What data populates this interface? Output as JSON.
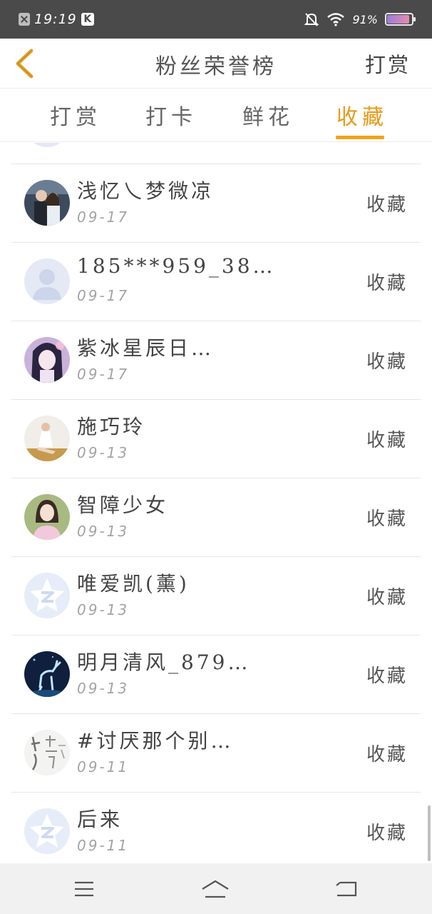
{
  "status_bar": {
    "time": "19:19",
    "battery_pct": "91%"
  },
  "header": {
    "title": "粉丝荣誉榜",
    "action": "打赏"
  },
  "tabs": [
    {
      "label": "打赏",
      "active": false
    },
    {
      "label": "打卡",
      "active": false
    },
    {
      "label": "鲜花",
      "active": false
    },
    {
      "label": "收藏",
      "active": true
    }
  ],
  "colors": {
    "accent": "#f0a21c",
    "status_bar": "#4a4a4a",
    "nav_bar": "#f1f1f1"
  },
  "list": [
    {
      "name": "浅忆乀梦微凉",
      "date": "09-17",
      "action": "收藏",
      "avatar": "photo-couple"
    },
    {
      "name": "185***959_38…",
      "date": "09-17",
      "action": "收藏",
      "avatar": "default-user"
    },
    {
      "name": "紫冰星辰日…",
      "date": "09-17",
      "action": "收藏",
      "avatar": "anime-girl"
    },
    {
      "name": "施巧玲",
      "date": "09-13",
      "action": "收藏",
      "avatar": "photo-girl"
    },
    {
      "name": "智障少女",
      "date": "09-13",
      "action": "收藏",
      "avatar": "photo-girl-pink"
    },
    {
      "name": "唯爱凯(薰)",
      "date": "09-13",
      "action": "收藏",
      "avatar": "qq-default"
    },
    {
      "name": "明月清风_879…",
      "date": "09-13",
      "action": "收藏",
      "avatar": "deer-night"
    },
    {
      "name": "#讨厌那个别…",
      "date": "09-11",
      "action": "收藏",
      "avatar": "calligraphy"
    },
    {
      "name": "后来",
      "date": "09-11",
      "action": "收藏",
      "avatar": "qq-default"
    }
  ]
}
